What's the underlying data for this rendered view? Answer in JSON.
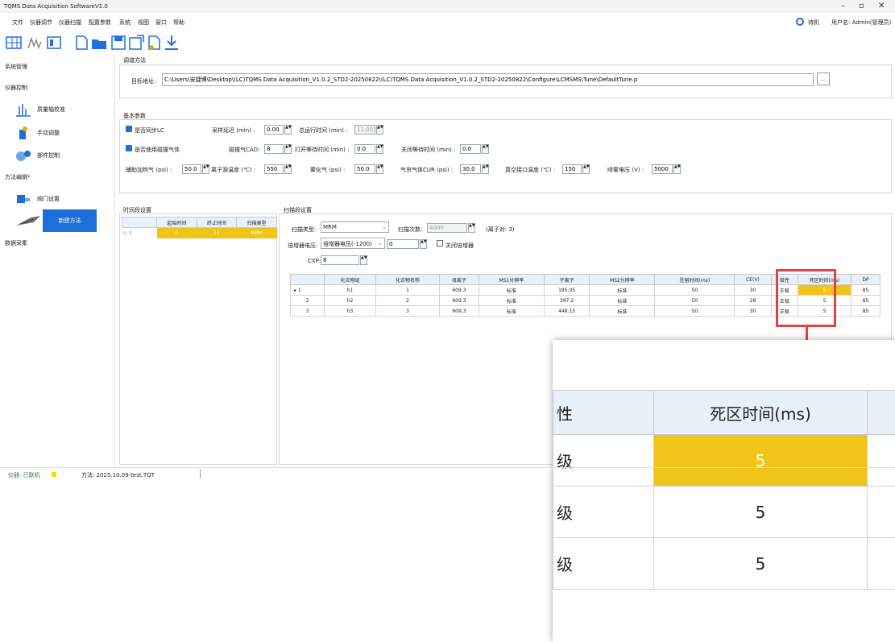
{
  "window": {
    "title": "TQMS Data Acquisition SoftwareV1.0",
    "standby": "待机",
    "user": "用户名: Admin(管理员)"
  },
  "menu": [
    "文件",
    "仪器调节",
    "仪器扫描",
    "配置参数",
    "系统",
    "视图",
    "窗口",
    "帮助"
  ],
  "sidebar": {
    "sys_mgmt": "系统管理",
    "instr_ctrl": "仪器控制",
    "calib": "质量轴校准",
    "manual": "手动调整",
    "parts": "部件控制",
    "method_edit": "方法编辑*",
    "valve": "阀门设置",
    "new_method": "新建方法",
    "data_acq": "数据采集"
  },
  "tune": {
    "group": "调谐方法",
    "label": "目标地址:",
    "path": "C:\\Users\\安捷博\\Desktop\\(LC)TQMS Data Acquisition_V1.0.2_STD2-20250822\\(LC)TQMS Data Acquisition_V1.0.2_STD2-20250822\\Configure\\LCMSMS\\Tune\\DefaultTune.p",
    "browse": "..."
  },
  "basic": {
    "group": "基本参数",
    "sync_lc": "是否同步LC",
    "delay_label": "采样延迟 (min) :",
    "delay": "0.00",
    "total_label": "总运行时间 (min) :",
    "total": "11.00",
    "collision": "是否使用碰撞气体",
    "cad_label": "碰撞气CAD:",
    "cad": "8",
    "open_wait_label": "打开等待时间 (min) :",
    "open_wait": "0.0",
    "close_wait_label": "关闭等待时间 (min) :",
    "close_wait": "0.0",
    "aux_label": "辅助加热气 (psi) :",
    "aux": "50.0",
    "src_temp_label": "离子源温度 (℃) :",
    "src_temp": "550",
    "neb_label": "雾化气 (psi) :",
    "neb": "50.0",
    "cur_label": "气帘气体CUR (psi) :",
    "cur": "30.0",
    "vac_label": "真空接口温度 (℃) :",
    "vac": "150",
    "spray_label": "喷雾电压 (V) :",
    "spray": "5000"
  },
  "time_seg": {
    "group": "时间段设置",
    "headers": [
      "起始时间",
      "终止时间",
      "扫描类型"
    ],
    "row": {
      "num": "1",
      "start": "0",
      "end": "11",
      "type": "MRM"
    }
  },
  "scan": {
    "group": "扫描段设置",
    "type_label": "扫描类型:",
    "type": "MRM",
    "count_label": "扫描次数:",
    "count": "4000",
    "pairs": "(离子对: 3)",
    "mult_label": "倍增器电压:",
    "mult": "倍增器电压(-1200)",
    "mult_val": "0",
    "close_mult": "关闭倍增器",
    "cxp_label": "CXP:",
    "cxp": "8"
  },
  "grid": {
    "headers": [
      "化合物组",
      "化合物名称",
      "母离子",
      "MS1分辨率",
      "子离子",
      "MS2分辨率",
      "驻留时间(ms)",
      "CE(V)",
      "极性",
      "死区时间(ms)",
      "DP"
    ],
    "rows": [
      {
        "idx": "1",
        "group": "h1",
        "name": "1",
        "parent": "609.3",
        "ms1": "标准",
        "child": "195.05",
        "ms2": "标准",
        "dwell": "50",
        "ce": "30",
        "pol": "正极",
        "dead": "5",
        "dp": "85"
      },
      {
        "idx": "2",
        "group": "h2",
        "name": "2",
        "parent": "609.3",
        "ms1": "标准",
        "child": "397.2",
        "ms2": "标准",
        "dwell": "50",
        "ce": "28",
        "pol": "正极",
        "dead": "5",
        "dp": "85"
      },
      {
        "idx": "3",
        "group": "h3",
        "name": "3",
        "parent": "609.3",
        "ms1": "标准",
        "child": "448.15",
        "ms2": "标准",
        "dwell": "50",
        "ce": "30",
        "pol": "正极",
        "dead": "5",
        "dp": "85"
      }
    ]
  },
  "zoom": {
    "prev_col": "性",
    "header": "死区时间(ms)",
    "pol": [
      "级",
      "级",
      "级"
    ],
    "vals": [
      "5",
      "5",
      "5"
    ]
  },
  "status": {
    "instr": "仪器: 已联机",
    "method": "方法: 2025.10.09-test.TQT"
  },
  "colors": {
    "accent": "#1e6fd9",
    "highlight": "#f0c418",
    "callout": "#e04343"
  }
}
